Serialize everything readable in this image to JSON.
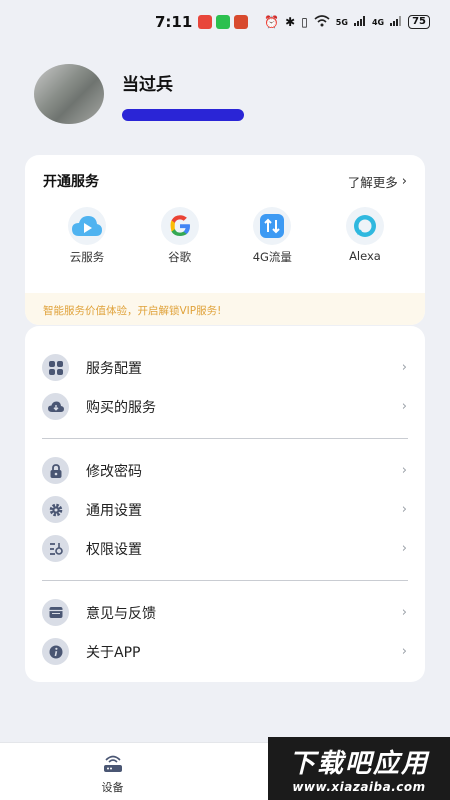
{
  "status_bar": {
    "time": "7:11",
    "battery": "75",
    "network_5g": "5G",
    "network_4g": "4G"
  },
  "profile": {
    "username": "当过兵"
  },
  "services": {
    "title": "开通服务",
    "more_label": "了解更多",
    "items": [
      {
        "label": "云服务",
        "icon": "cloud-play-icon"
      },
      {
        "label": "谷歌",
        "icon": "google-icon"
      },
      {
        "label": "4G流量",
        "icon": "data-4g-icon"
      },
      {
        "label": "Alexa",
        "icon": "alexa-icon"
      }
    ],
    "promo": "智能服务价值体验，开启解锁VIP服务!"
  },
  "menu": {
    "groups": [
      [
        {
          "label": "服务配置",
          "icon": "grid-icon"
        },
        {
          "label": "购买的服务",
          "icon": "cloud-download-icon"
        }
      ],
      [
        {
          "label": "修改密码",
          "icon": "lock-icon"
        },
        {
          "label": "通用设置",
          "icon": "gear-icon"
        },
        {
          "label": "权限设置",
          "icon": "permission-icon"
        }
      ],
      [
        {
          "label": "意见与反馈",
          "icon": "feedback-icon"
        },
        {
          "label": "关于APP",
          "icon": "info-icon"
        }
      ]
    ]
  },
  "bottom_nav": {
    "tabs": [
      {
        "label": "设备",
        "icon": "router-icon"
      }
    ]
  },
  "watermark": {
    "title": "下载吧应用",
    "url": "www.xiazaiba.com"
  },
  "colors": {
    "background": "#eef0f5",
    "promo_bg": "#fdf8ec",
    "promo_text": "#e0a23a",
    "icon_bg": "#d9dde6",
    "icon_fg": "#4a5673"
  }
}
